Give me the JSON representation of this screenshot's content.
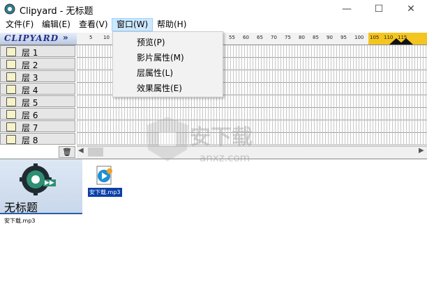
{
  "window": {
    "title": "Clipyard - 无标题",
    "minimize": "—",
    "maximize": "☐",
    "close": "✕"
  },
  "menubar": {
    "items": [
      {
        "label": "文件(F)"
      },
      {
        "label": "编辑(E)"
      },
      {
        "label": "查看(V)"
      },
      {
        "label": "窗口(W)"
      },
      {
        "label": "帮助(H)"
      }
    ]
  },
  "window_menu": {
    "items": [
      {
        "label": "预览(P)"
      },
      {
        "label": "影片属性(M)"
      },
      {
        "label": "层属性(L)"
      },
      {
        "label": "效果属性(E)"
      }
    ]
  },
  "logo": {
    "text": "CLIPYARD",
    "arrows": "»"
  },
  "ruler": {
    "ticks": [
      "5",
      "10",
      "55",
      "60",
      "65",
      "70",
      "75",
      "80",
      "85",
      "90",
      "95",
      "100",
      "105",
      "110",
      "115"
    ]
  },
  "layers": [
    {
      "label": "层 1"
    },
    {
      "label": "层 2"
    },
    {
      "label": "层 3"
    },
    {
      "label": "层 4"
    },
    {
      "label": "层 5"
    },
    {
      "label": "层 6"
    },
    {
      "label": "层 7"
    },
    {
      "label": "层 8"
    }
  ],
  "project": {
    "title": "无标题",
    "file": "安下载.mp3"
  },
  "clip": {
    "label": "安下载.mp3"
  },
  "watermark": {
    "text": "安下载",
    "sub": "anxz.com"
  },
  "colors": {
    "accent": "#0a3fa6",
    "menu_highlight": "#cce8ff",
    "ruler_highlight": "#f4c51f"
  }
}
